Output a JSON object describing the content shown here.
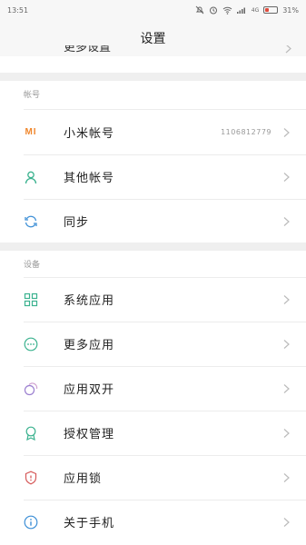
{
  "status_bar": {
    "time": "13:51",
    "signal_label": "4G",
    "battery_text": "31%",
    "battery_level": 0.31
  },
  "header": {
    "title": "设置"
  },
  "partial_item": {
    "label": "更多设置"
  },
  "sections": [
    {
      "header": "帐号",
      "items": [
        {
          "label": "小米帐号",
          "value": "1106812779",
          "icon": "mi-logo-icon"
        },
        {
          "label": "其他帐号",
          "value": "",
          "icon": "person-icon"
        },
        {
          "label": "同步",
          "value": "",
          "icon": "sync-icon"
        }
      ]
    },
    {
      "header": "设备",
      "items": [
        {
          "label": "系统应用",
          "icon": "grid-icon"
        },
        {
          "label": "更多应用",
          "icon": "more-dots-icon"
        },
        {
          "label": "应用双开",
          "icon": "dual-app-icon"
        },
        {
          "label": "授权管理",
          "icon": "ribbon-icon"
        },
        {
          "label": "应用锁",
          "icon": "shield-lock-icon"
        },
        {
          "label": "关于手机",
          "icon": "info-icon"
        }
      ]
    }
  ],
  "colors": {
    "mi_orange": "#f0872d",
    "teal": "#3bb28f",
    "purple": "#9b7fd0",
    "red": "#d65a5a",
    "blue": "#3d8fd6"
  }
}
